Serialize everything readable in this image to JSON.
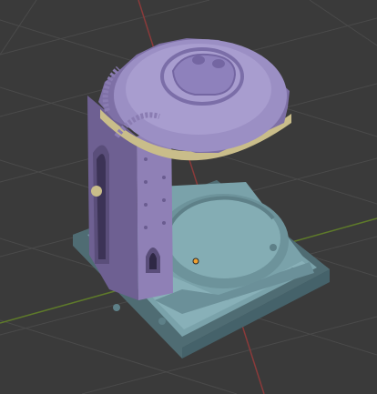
{
  "viewport": {
    "background": "#3a3a3a",
    "grid_color": "#454545",
    "x_axis_color": "#8a3a3a",
    "y_axis_color": "#5e7a2a"
  },
  "scene": {
    "base_color": "#7aa2aa",
    "base_shadow": "#5e8088",
    "tower_color": "#8f80b6",
    "tower_shadow": "#6e6092",
    "dome_color": "#9b8fc4",
    "accent_tan": "#c9bd8a",
    "origin_color": "#f0a030",
    "icons": [
      "skull-emblem-icon",
      "gear-rim-icon",
      "cable-icon",
      "origin-dot-icon"
    ]
  }
}
